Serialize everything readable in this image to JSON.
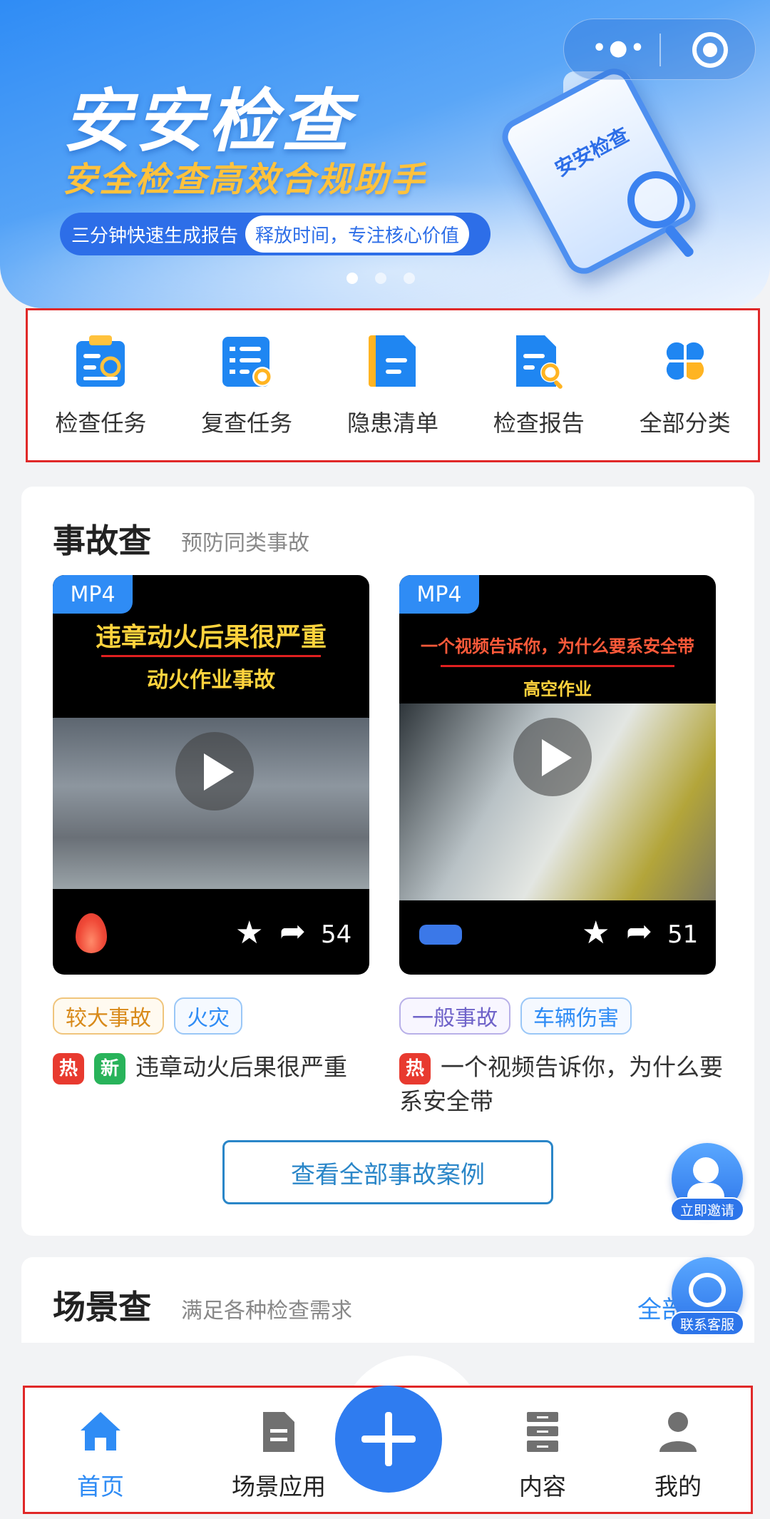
{
  "banner": {
    "title": "安安检查",
    "subtitle": "安全检查高效合规助手",
    "pill_left": "三分钟快速生成报告",
    "pill_right": "释放时间，专注核心价值",
    "phone_label": "安安检查",
    "slides_count": 3,
    "active_slide": 1
  },
  "capsule": {
    "more_icon": "more-dots-icon",
    "target_icon": "target-icon"
  },
  "quick_menu": [
    {
      "label": "检查任务",
      "icon": "inspection-task-icon"
    },
    {
      "label": "复查任务",
      "icon": "recheck-task-icon"
    },
    {
      "label": "隐患清单",
      "icon": "hazard-list-icon"
    },
    {
      "label": "检查报告",
      "icon": "inspection-report-icon"
    },
    {
      "label": "全部分类",
      "icon": "all-categories-icon"
    }
  ],
  "accident": {
    "title": "事故查",
    "subtitle": "预防同类事故",
    "videos": [
      {
        "badge": "MP4",
        "headline": "违章动火后果很严重",
        "subheadline": "动火作业事故",
        "count": "54",
        "tags": [
          "较大事故",
          "火灾"
        ],
        "hot": "热",
        "new": "新",
        "desc": "违章动火后果很严重"
      },
      {
        "badge": "MP4",
        "headline": "一个视频告诉你，为什么要系安全带",
        "subheadline": "高空作业",
        "count": "51",
        "tags": [
          "一般事故",
          "车辆伤害"
        ],
        "hot": "热",
        "desc": "一个视频告诉你，为什么要系安全带"
      }
    ],
    "view_all": "查看全部事故案例"
  },
  "scene": {
    "title": "场景查",
    "subtitle": "满足各种检查需求",
    "all_label": "全部"
  },
  "floating": {
    "invite": "立即邀请",
    "service": "联系客服"
  },
  "nav": [
    {
      "label": "首页",
      "icon": "home-icon",
      "active": true
    },
    {
      "label": "场景应用",
      "icon": "document-icon"
    },
    {
      "label": "内容",
      "icon": "stack-icon"
    },
    {
      "label": "我的",
      "icon": "user-icon"
    }
  ],
  "colors": {
    "primary": "#2f8cf5",
    "highlight": "#e02828",
    "accent_yellow": "#ffc23d"
  }
}
